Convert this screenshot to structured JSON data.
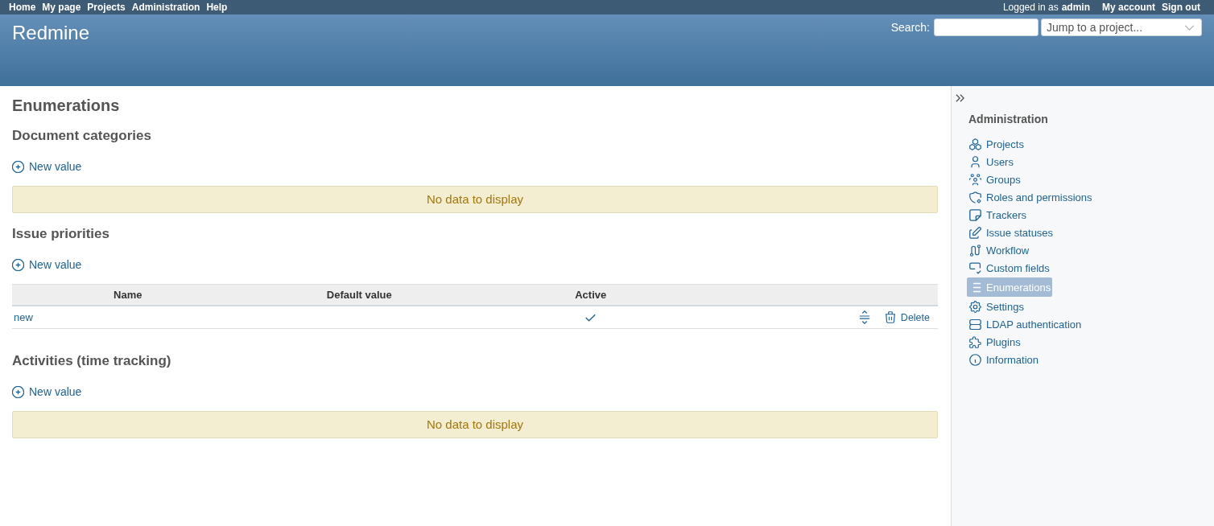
{
  "top_menu": {
    "items": [
      "Home",
      "My page",
      "Projects",
      "Administration",
      "Help"
    ],
    "logged_in": {
      "prefix": "Logged in as",
      "user": "admin"
    },
    "account_items": [
      "My account",
      "Sign out"
    ]
  },
  "header": {
    "title": "Redmine",
    "search": {
      "label": "Search:"
    },
    "project_jump": {
      "text": "Jump to a project..."
    }
  },
  "content": {
    "title": "Enumerations",
    "sections": [
      {
        "title": "Document categories",
        "new_link": "New value",
        "kind": "empty",
        "message": "No data to display"
      },
      {
        "title": "Issue priorities",
        "new_link": "New value",
        "kind": "table",
        "columns": [
          "Name",
          "Default value",
          "Active"
        ],
        "rows": [
          {
            "name": "new",
            "active": true,
            "action": "Delete"
          }
        ]
      },
      {
        "title": "Activities (time tracking)",
        "new_link": "New value",
        "kind": "empty",
        "message": "No data to display"
      }
    ]
  },
  "sidebar": {
    "title": "Administration",
    "items": [
      {
        "label": "Projects",
        "selected": false
      },
      {
        "label": "Users",
        "selected": false
      },
      {
        "label": "Groups",
        "selected": false
      },
      {
        "label": "Roles and permissions",
        "selected": false
      },
      {
        "label": "Trackers",
        "selected": false
      },
      {
        "label": "Issue statuses",
        "selected": false
      },
      {
        "label": "Workflow",
        "selected": false
      },
      {
        "label": "Custom fields",
        "selected": false
      },
      {
        "label": "Enumerations",
        "selected": true
      },
      {
        "label": "Settings",
        "selected": false
      },
      {
        "label": "LDAP authentication",
        "selected": false
      },
      {
        "label": "Plugins",
        "selected": false
      },
      {
        "label": "Information",
        "selected": false
      }
    ]
  }
}
